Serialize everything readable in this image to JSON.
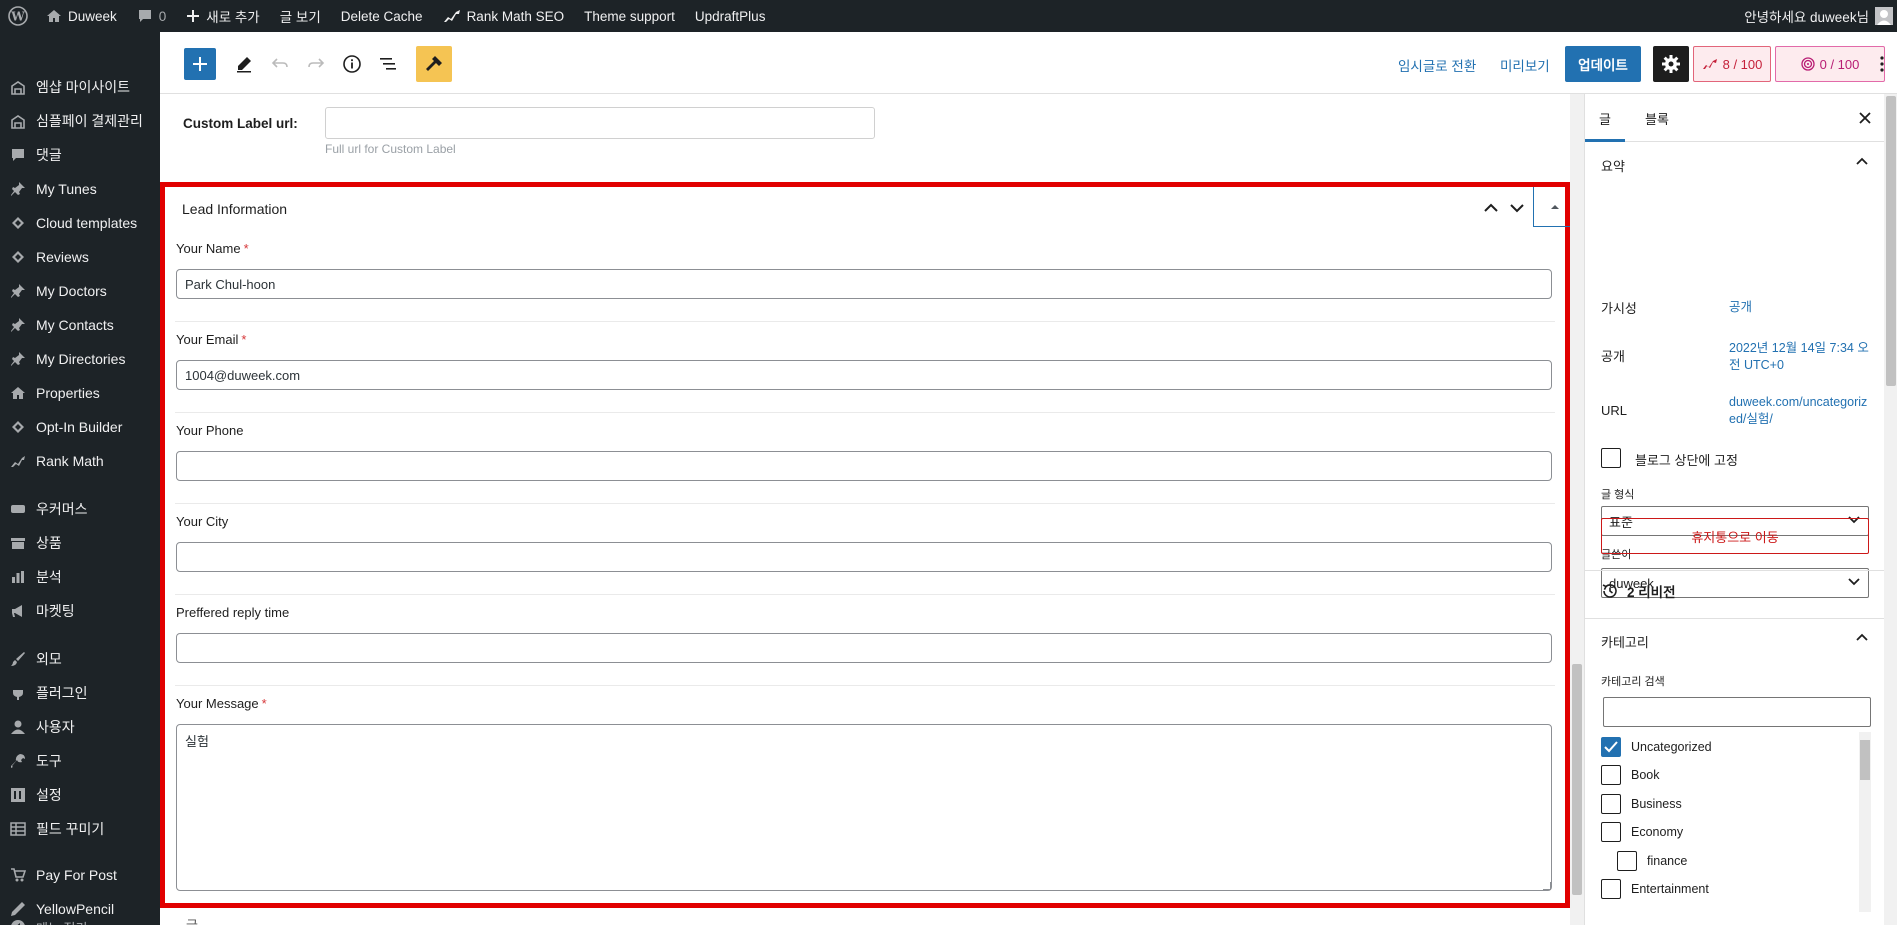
{
  "admin_bar": {
    "site_name": "Duweek",
    "comments_count": "0",
    "new_label": "새로 추가",
    "view_post": "글 보기",
    "delete_cache": "Delete Cache",
    "rank_math": "Rank Math SEO",
    "theme_support": "Theme support",
    "updraft": "UpdraftPlus",
    "greeting": "안녕하세요 duweek님"
  },
  "sidebar": {
    "items": [
      {
        "label": "엠샵 마이사이트",
        "icon": "building-icon"
      },
      {
        "label": "심플페이 결제관리",
        "icon": "building-icon"
      },
      {
        "label": "댓글",
        "icon": "comment-icon"
      },
      {
        "label": "My Tunes",
        "icon": "pin-icon"
      },
      {
        "label": "Cloud templates",
        "icon": "diamond-icon"
      },
      {
        "label": "Reviews",
        "icon": "diamond-icon"
      },
      {
        "label": "My Doctors",
        "icon": "pin-icon"
      },
      {
        "label": "My Contacts",
        "icon": "pin-icon"
      },
      {
        "label": "My Directories",
        "icon": "pin-icon"
      },
      {
        "label": "Properties",
        "icon": "house-icon"
      },
      {
        "label": "Opt-In Builder",
        "icon": "diamond-icon"
      },
      {
        "label": "Rank Math",
        "icon": "chart-icon"
      },
      {
        "label": "우커머스",
        "icon": "woo-icon"
      },
      {
        "label": "상품",
        "icon": "archive-icon"
      },
      {
        "label": "분석",
        "icon": "bar-chart-icon"
      },
      {
        "label": "마켓팅",
        "icon": "megaphone-icon"
      },
      {
        "label": "외모",
        "icon": "brush-icon"
      },
      {
        "label": "플러그인",
        "icon": "plug-icon"
      },
      {
        "label": "사용자",
        "icon": "user-icon"
      },
      {
        "label": "도구",
        "icon": "wrench-icon"
      },
      {
        "label": "설정",
        "icon": "settings-icon"
      },
      {
        "label": "필드 꾸미기",
        "icon": "table-icon"
      },
      {
        "label": "Pay For Post",
        "icon": "cart-icon"
      },
      {
        "label": "YellowPencil",
        "icon": "pencil-icon"
      }
    ],
    "collapse_label": "메뉴 접기"
  },
  "toolbar": {
    "switch_draft": "임시글로 전환",
    "preview": "미리보기",
    "update": "업데이트",
    "seo_score": "8 / 100",
    "content_score": "0 / 100"
  },
  "editor": {
    "custom_label_url": {
      "label": "Custom Label url:",
      "value": "",
      "help": "Full url for Custom Label"
    },
    "lead_info": {
      "title": "Lead Information",
      "fields": [
        {
          "label": "Your Name",
          "required": "*",
          "value": "Park Chul-hoon"
        },
        {
          "label": "Your Email",
          "required": "*",
          "value": "1004@duweek.com"
        },
        {
          "label": "Your Phone",
          "required": "",
          "value": ""
        },
        {
          "label": "Your City",
          "required": "",
          "value": ""
        },
        {
          "label": "Preffered reply time",
          "required": "",
          "value": ""
        },
        {
          "label": "Your Message",
          "required": "*",
          "value": "실험"
        }
      ]
    },
    "below_text": "글"
  },
  "settings": {
    "tabs": [
      "글",
      "블록"
    ],
    "summary": {
      "title": "요약",
      "visibility_label": "가시성",
      "visibility_value": "공개",
      "publish_label": "공개",
      "publish_value": "2022년 12월 14일 7:34 오전 UTC+0",
      "url_label": "URL",
      "url_value": "duweek.com/uncategorized/실험/",
      "sticky_label": "블로그 상단에 고정",
      "format_label": "글 형식",
      "format_value": "표준",
      "author_label": "글쓴이",
      "author_value": "duweek",
      "trash_label": "휴지통으로 이동"
    },
    "revisions": "2 리비전",
    "categories": {
      "title": "카테고리",
      "search_label": "카테고리 검색",
      "search_value": "",
      "items": [
        {
          "label": "Uncategorized",
          "checked": true
        },
        {
          "label": "Book",
          "checked": false
        },
        {
          "label": "Business",
          "checked": false
        },
        {
          "label": "Economy",
          "checked": false
        },
        {
          "label": "finance",
          "checked": false
        },
        {
          "label": "Entertainment",
          "checked": false
        }
      ]
    }
  },
  "colors": {
    "accent": "#2271b1",
    "admin_dark": "#1d2327",
    "highlight_border": "#e10000",
    "danger": "#cc1818"
  }
}
